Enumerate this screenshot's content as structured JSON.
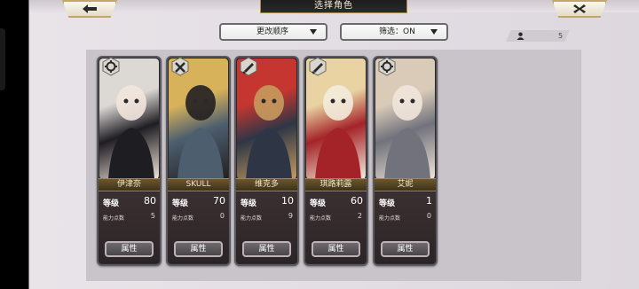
{
  "header": {
    "title": "选择角色",
    "back_icon": "back-arrow-icon",
    "close_icon": "close-x-icon"
  },
  "controls": {
    "sort_label": "更改顺序",
    "filter_label": "筛选：ON"
  },
  "roster": {
    "count": "5",
    "icon": "user-icon"
  },
  "labels": {
    "level": "等级",
    "ability_points": "能力点数",
    "attributes": "属性"
  },
  "characters": [
    {
      "name": "伊津奈",
      "level": "80",
      "ability_points": "5",
      "badge_icon": "gear-bell-icon",
      "colors": [
        "#dcd8d4",
        "#1e1d22",
        "#f2e6dc"
      ]
    },
    {
      "name": "SKULL",
      "level": "70",
      "ability_points": "0",
      "badge_icon": "cross-tools-icon",
      "colors": [
        "#d8b25a",
        "#4d5e6e",
        "#231f22"
      ]
    },
    {
      "name": "维克多",
      "level": "10",
      "ability_points": "9",
      "badge_icon": "sword-icon",
      "colors": [
        "#c4362f",
        "#2e3646",
        "#c79b5e"
      ]
    },
    {
      "name": "琪路莉露",
      "level": "60",
      "ability_points": "2",
      "badge_icon": "sword-icon",
      "colors": [
        "#e9d3a2",
        "#a42328",
        "#f3ebdc"
      ]
    },
    {
      "name": "艾妮",
      "level": "1",
      "ability_points": "0",
      "badge_icon": "gear-bell-icon",
      "colors": [
        "#d9cbb8",
        "#72727c",
        "#efe6da"
      ]
    }
  ]
}
